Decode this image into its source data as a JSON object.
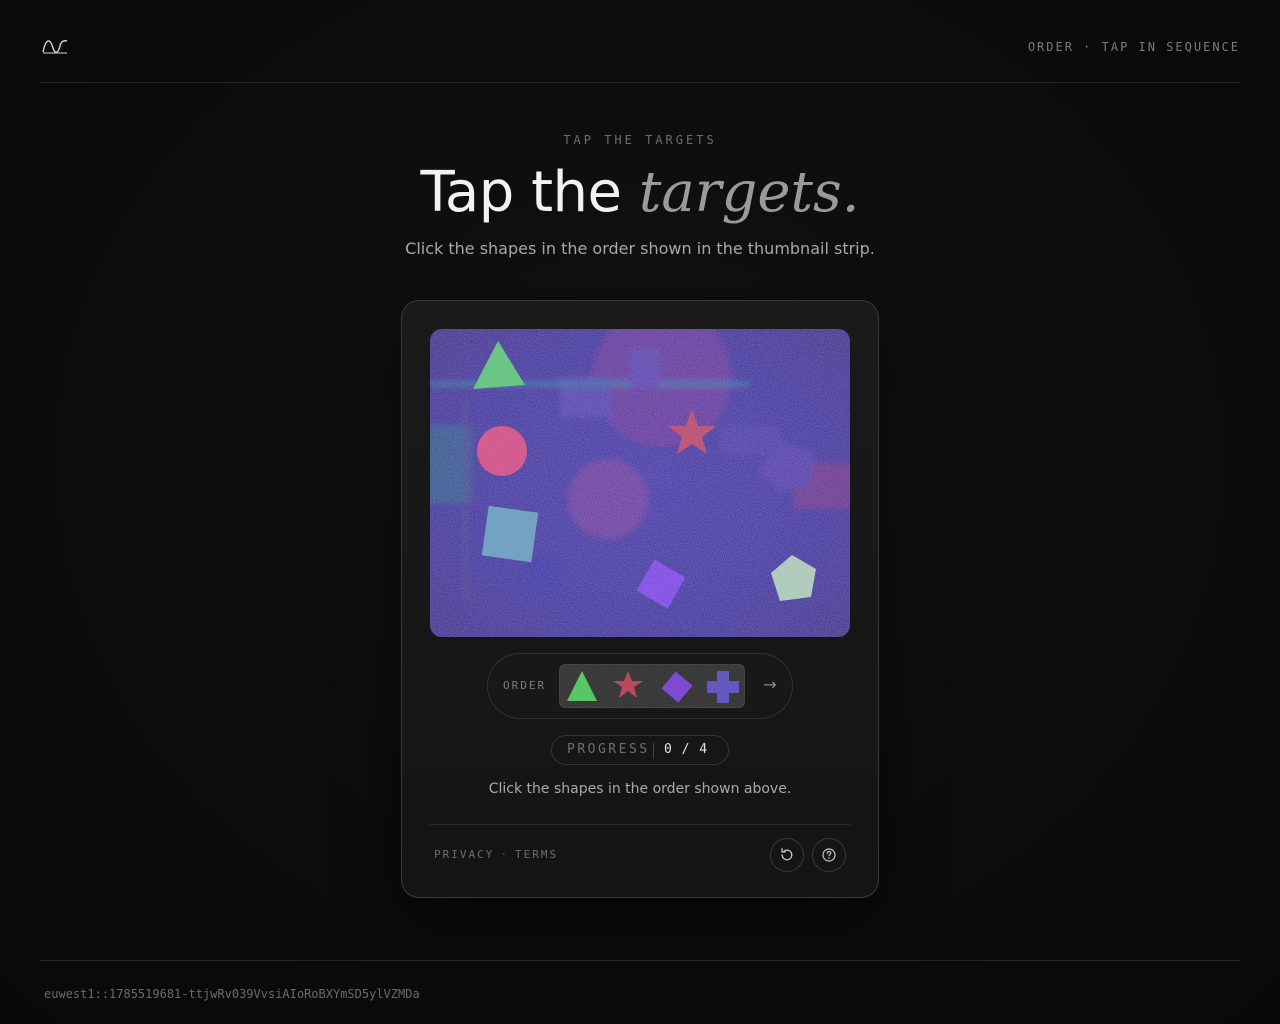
{
  "header": {
    "logo_icon": "wave-logo-icon",
    "right_label": "ORDER · TAP IN SEQUENCE"
  },
  "hero": {
    "eyebrow": "TAP THE TARGETS",
    "title_plain": "Tap the",
    "title_accent": "targets.",
    "subtitle": "Click the shapes in the order shown in the thumbnail strip."
  },
  "challenge": {
    "canvas_shapes": [
      "triangle",
      "circle",
      "star",
      "square",
      "diamond",
      "pentagon",
      "cross"
    ],
    "order_label": "ORDER",
    "order_sequence": [
      "triangle",
      "star",
      "diamond",
      "cross"
    ],
    "next_arrow": "→",
    "progress_label": "PROGRESS",
    "progress_value": "0 / 4",
    "progress_done": 0,
    "progress_total": 4,
    "instruction": "Click the shapes in the order shown above."
  },
  "footer": {
    "privacy": "PRIVACY",
    "separator": "·",
    "terms": "TERMS",
    "refresh_icon": "refresh-icon",
    "help_icon": "help-icon",
    "ray_id": "euwest1::1785519681-ttjwRv039VvsiAIoRoBXYmSD5ylVZMDa"
  },
  "colors": {
    "background": "#0b0b0b",
    "card": "#171717",
    "canvas_base": "#3a2f8f",
    "triangle": "#4ed05a",
    "star": "#c23a4e",
    "diamond": "#7a3ae0",
    "cross": "#5a4ac8",
    "circle": "#e0406a",
    "square": "#5aa0b0",
    "pentagon": "#b0d8a8"
  }
}
